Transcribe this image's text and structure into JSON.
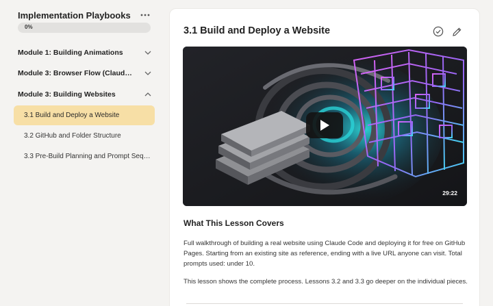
{
  "sidebar": {
    "course_title": "Implementation Playbooks",
    "progress": {
      "label": "0%",
      "fraction": 0
    },
    "modules": [
      {
        "label": "Module 1: Building Animations",
        "expanded": false
      },
      {
        "label": "Module 3: Browser Flow (Claude Ex...",
        "expanded": false
      },
      {
        "label": "Module 3: Building Websites",
        "expanded": true
      }
    ],
    "lessons": [
      {
        "label": "3.1 Build and Deploy a Website",
        "active": true
      },
      {
        "label": "3.2 GitHub and Folder Structure",
        "active": false
      },
      {
        "label": "3.3 Pre-Build Planning and Prompt Sequ...",
        "active": false
      }
    ]
  },
  "main": {
    "title": "3.1 Build and Deploy a Website",
    "video": {
      "duration": "29:22"
    },
    "section_heading": "What This Lesson Covers",
    "paragraphs": [
      "Full walkthrough of building a real website using Claude Code and deploying it for free on GitHub Pages. Starting from an existing site as reference, ending with a live URL anyone can visit. Total prompts used: under 10.",
      "This lesson shows the complete process. Lessons 3.2 and 3.3 go deeper on the individual pieces."
    ]
  },
  "colors": {
    "active_lesson_bg": "#f7dfa6",
    "page_bg": "#f4f3f1",
    "card_bg": "#ffffff"
  },
  "icons": {
    "course_menu": "more-horizontal-icon",
    "complete": "check-circle-icon",
    "edit": "pencil-icon",
    "play": "play-icon"
  }
}
